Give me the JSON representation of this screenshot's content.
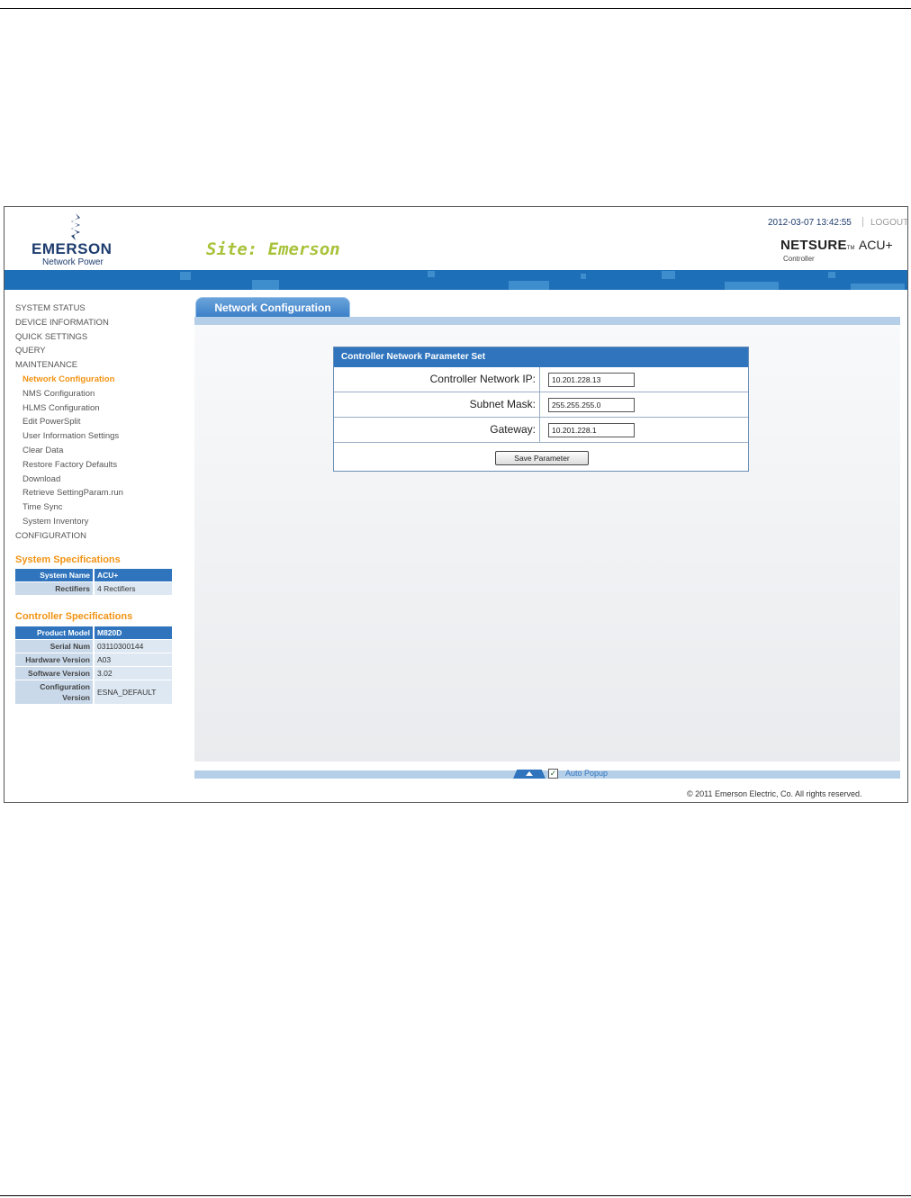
{
  "header": {
    "brand": "EMERSON",
    "brand_sub": "Network Power",
    "site_title": "Site: Emerson",
    "datetime": "2012-03-07 13:42:55",
    "logout": "LOGOUT",
    "product_name": "NETSURE",
    "product_tm": "TM",
    "product_model": "ACU+",
    "product_sub": "Controller"
  },
  "nav": {
    "items": [
      {
        "label": "SYSTEM STATUS"
      },
      {
        "label": "DEVICE INFORMATION"
      },
      {
        "label": "QUICK SETTINGS"
      },
      {
        "label": "QUERY"
      },
      {
        "label": "MAINTENANCE"
      },
      {
        "label": "Network Configuration"
      },
      {
        "label": "NMS Configuration"
      },
      {
        "label": "HLMS Configuration"
      },
      {
        "label": "Edit PowerSplit"
      },
      {
        "label": "User Information Settings"
      },
      {
        "label": "Clear Data"
      },
      {
        "label": "Restore Factory Defaults"
      },
      {
        "label": "Download"
      },
      {
        "label": "Retrieve SettingParam.run"
      },
      {
        "label": "Time Sync"
      },
      {
        "label": "System Inventory"
      },
      {
        "label": "CONFIGURATION"
      }
    ]
  },
  "system_specs": {
    "title": "System Specifications",
    "rows": [
      {
        "k": "System Name",
        "v": "ACU+"
      },
      {
        "k": "Rectifiers",
        "v": "4 Rectifiers"
      }
    ]
  },
  "controller_specs": {
    "title": "Controller Specifications",
    "rows": [
      {
        "k": "Product Model",
        "v": "M820D"
      },
      {
        "k": "Serial Num",
        "v": "03110300144"
      },
      {
        "k": "Hardware Version",
        "v": "A03"
      },
      {
        "k": "Software Version",
        "v": "3.02"
      },
      {
        "k": "Configuration Version",
        "v": "ESNA_DEFAULT"
      }
    ]
  },
  "main": {
    "tab": "Network Configuration",
    "panel_title": "Controller Network Parameter Set",
    "fields": [
      {
        "label": "Controller Network IP:",
        "value": "10.201.228.13"
      },
      {
        "label": "Subnet Mask:",
        "value": "255.255.255.0"
      },
      {
        "label": "Gateway:",
        "value": "10.201.228.1"
      }
    ],
    "save_label": "Save Parameter"
  },
  "footer": {
    "auto_popup": "Auto Popup",
    "auto_popup_checked": true,
    "copyright": "© 2011 Emerson Electric, Co. All rights reserved."
  }
}
